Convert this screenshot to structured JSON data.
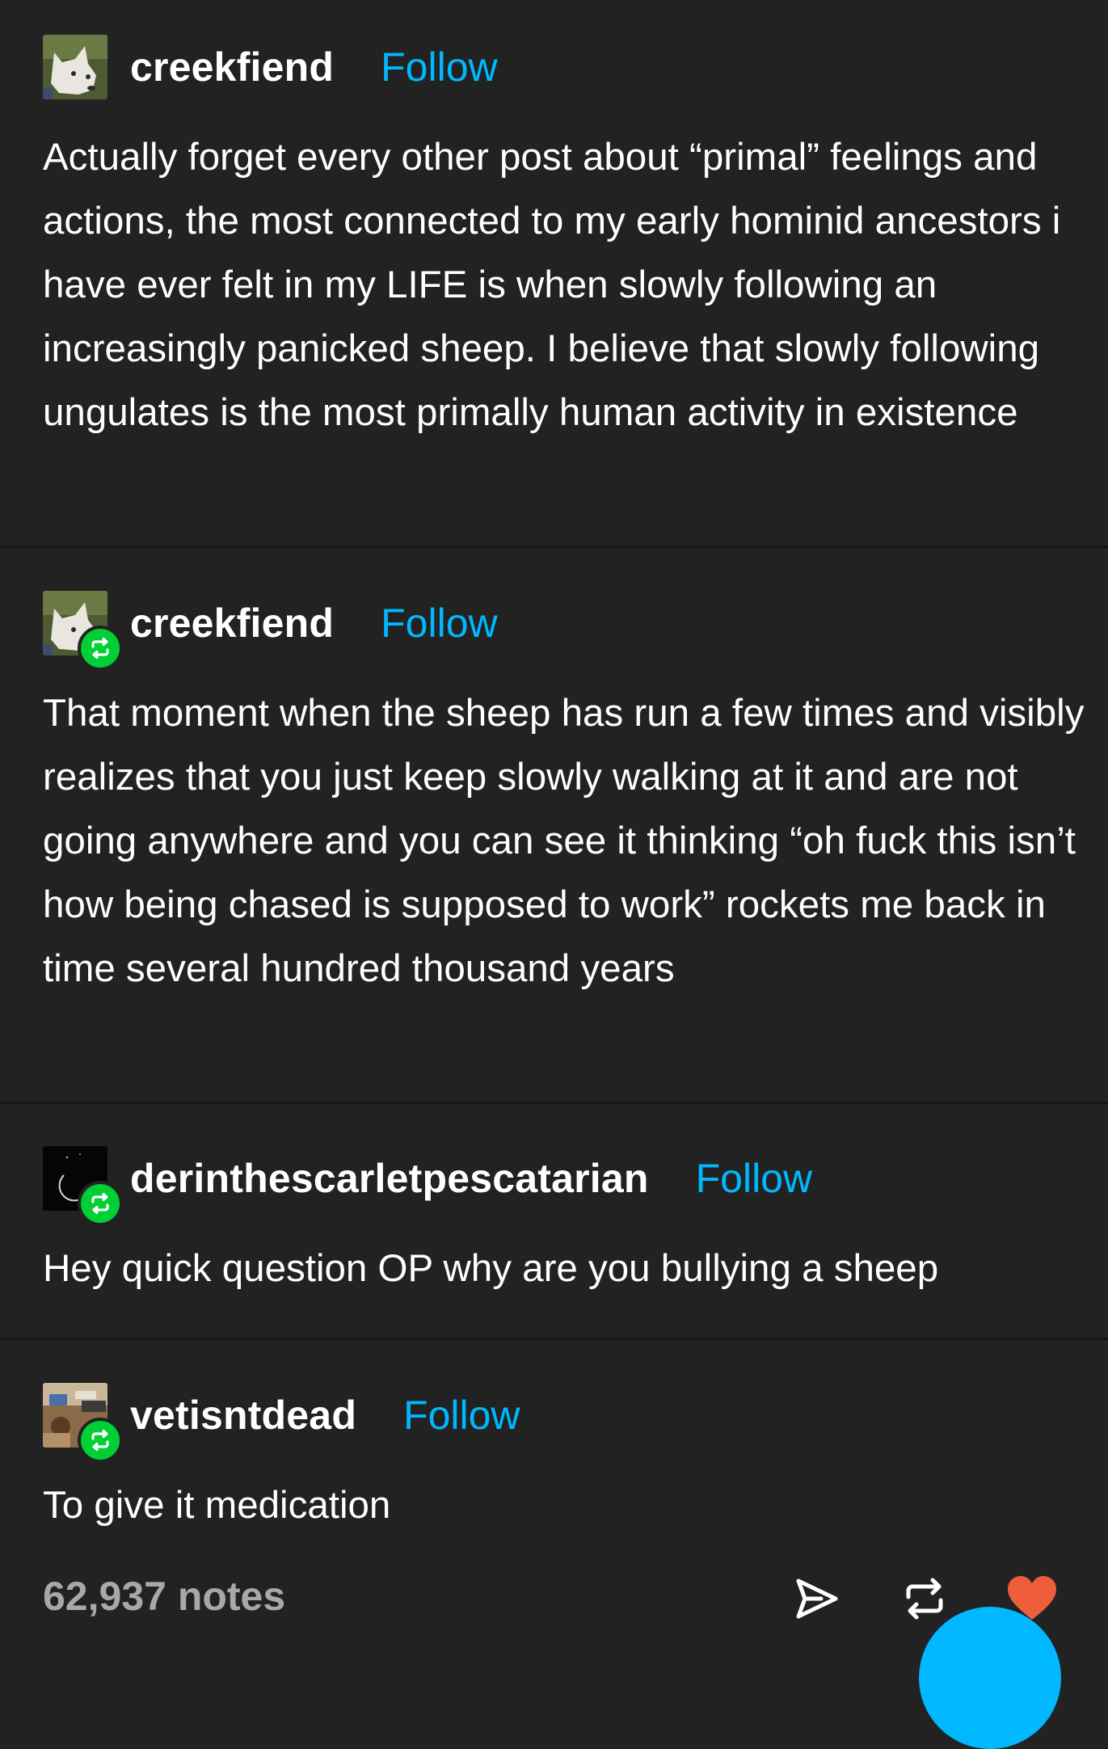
{
  "posts": [
    {
      "username": "creekfiend",
      "follow_label": "Follow",
      "body": "Actually forget every other post about “primal” feelings and actions, the most connected to my early hominid ancestors i have ever felt in my LIFE is when slowly following an increasingly panicked sheep. I believe that slowly following ungulates is the most primally human activity in existence",
      "avatar_icon": "white-dog-avatar"
    },
    {
      "username": "creekfiend",
      "follow_label": "Follow",
      "body": "That moment when the sheep has run a few times and visibly realizes that you just keep slowly walking at it and are not going anywhere and you can see it thinking “oh fuck this isn’t how being chased is supposed to work” rockets me back in time several hundred thousand years",
      "avatar_icon": "white-dog-avatar",
      "reblog_icon": "reblog-icon"
    },
    {
      "username": "derinthescarletpescatarian",
      "follow_label": "Follow",
      "body": "Hey quick question OP why are you bullying a sheep",
      "avatar_icon": "dark-moon-avatar",
      "reblog_icon": "reblog-icon"
    },
    {
      "username": "vetisntdead",
      "follow_label": "Follow",
      "body": "To give it medication",
      "avatar_icon": "desk-photo-avatar",
      "reblog_icon": "reblog-icon"
    }
  ],
  "footer": {
    "notes": "62,937 notes",
    "share_icon": "share-icon",
    "reblog_icon": "reblog-icon",
    "like_icon": "heart-icon"
  },
  "colors": {
    "background": "#222222",
    "text": "#ffffff",
    "follow": "#00b8ff",
    "reblog_badge": "#00cf35",
    "notes": "#a8a8a8",
    "heart": "#ee5e3a"
  }
}
